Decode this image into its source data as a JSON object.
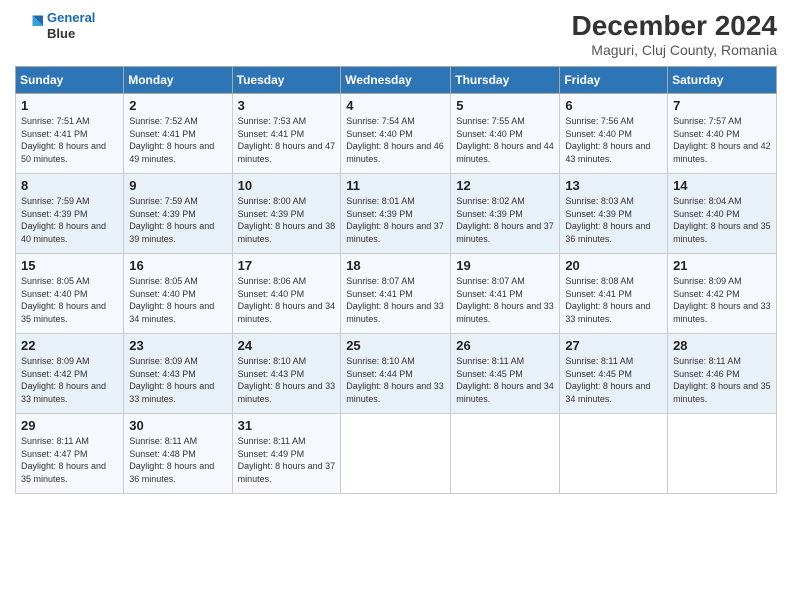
{
  "header": {
    "logo_line1": "General",
    "logo_line2": "Blue",
    "title": "December 2024",
    "subtitle": "Maguri, Cluj County, Romania"
  },
  "weekdays": [
    "Sunday",
    "Monday",
    "Tuesday",
    "Wednesday",
    "Thursday",
    "Friday",
    "Saturday"
  ],
  "weeks": [
    [
      {
        "day": "1",
        "sunrise": "Sunrise: 7:51 AM",
        "sunset": "Sunset: 4:41 PM",
        "daylight": "Daylight: 8 hours and 50 minutes."
      },
      {
        "day": "2",
        "sunrise": "Sunrise: 7:52 AM",
        "sunset": "Sunset: 4:41 PM",
        "daylight": "Daylight: 8 hours and 49 minutes."
      },
      {
        "day": "3",
        "sunrise": "Sunrise: 7:53 AM",
        "sunset": "Sunset: 4:41 PM",
        "daylight": "Daylight: 8 hours and 47 minutes."
      },
      {
        "day": "4",
        "sunrise": "Sunrise: 7:54 AM",
        "sunset": "Sunset: 4:40 PM",
        "daylight": "Daylight: 8 hours and 46 minutes."
      },
      {
        "day": "5",
        "sunrise": "Sunrise: 7:55 AM",
        "sunset": "Sunset: 4:40 PM",
        "daylight": "Daylight: 8 hours and 44 minutes."
      },
      {
        "day": "6",
        "sunrise": "Sunrise: 7:56 AM",
        "sunset": "Sunset: 4:40 PM",
        "daylight": "Daylight: 8 hours and 43 minutes."
      },
      {
        "day": "7",
        "sunrise": "Sunrise: 7:57 AM",
        "sunset": "Sunset: 4:40 PM",
        "daylight": "Daylight: 8 hours and 42 minutes."
      }
    ],
    [
      {
        "day": "8",
        "sunrise": "Sunrise: 7:59 AM",
        "sunset": "Sunset: 4:39 PM",
        "daylight": "Daylight: 8 hours and 40 minutes."
      },
      {
        "day": "9",
        "sunrise": "Sunrise: 7:59 AM",
        "sunset": "Sunset: 4:39 PM",
        "daylight": "Daylight: 8 hours and 39 minutes."
      },
      {
        "day": "10",
        "sunrise": "Sunrise: 8:00 AM",
        "sunset": "Sunset: 4:39 PM",
        "daylight": "Daylight: 8 hours and 38 minutes."
      },
      {
        "day": "11",
        "sunrise": "Sunrise: 8:01 AM",
        "sunset": "Sunset: 4:39 PM",
        "daylight": "Daylight: 8 hours and 37 minutes."
      },
      {
        "day": "12",
        "sunrise": "Sunrise: 8:02 AM",
        "sunset": "Sunset: 4:39 PM",
        "daylight": "Daylight: 8 hours and 37 minutes."
      },
      {
        "day": "13",
        "sunrise": "Sunrise: 8:03 AM",
        "sunset": "Sunset: 4:39 PM",
        "daylight": "Daylight: 8 hours and 36 minutes."
      },
      {
        "day": "14",
        "sunrise": "Sunrise: 8:04 AM",
        "sunset": "Sunset: 4:40 PM",
        "daylight": "Daylight: 8 hours and 35 minutes."
      }
    ],
    [
      {
        "day": "15",
        "sunrise": "Sunrise: 8:05 AM",
        "sunset": "Sunset: 4:40 PM",
        "daylight": "Daylight: 8 hours and 35 minutes."
      },
      {
        "day": "16",
        "sunrise": "Sunrise: 8:05 AM",
        "sunset": "Sunset: 4:40 PM",
        "daylight": "Daylight: 8 hours and 34 minutes."
      },
      {
        "day": "17",
        "sunrise": "Sunrise: 8:06 AM",
        "sunset": "Sunset: 4:40 PM",
        "daylight": "Daylight: 8 hours and 34 minutes."
      },
      {
        "day": "18",
        "sunrise": "Sunrise: 8:07 AM",
        "sunset": "Sunset: 4:41 PM",
        "daylight": "Daylight: 8 hours and 33 minutes."
      },
      {
        "day": "19",
        "sunrise": "Sunrise: 8:07 AM",
        "sunset": "Sunset: 4:41 PM",
        "daylight": "Daylight: 8 hours and 33 minutes."
      },
      {
        "day": "20",
        "sunrise": "Sunrise: 8:08 AM",
        "sunset": "Sunset: 4:41 PM",
        "daylight": "Daylight: 8 hours and 33 minutes."
      },
      {
        "day": "21",
        "sunrise": "Sunrise: 8:09 AM",
        "sunset": "Sunset: 4:42 PM",
        "daylight": "Daylight: 8 hours and 33 minutes."
      }
    ],
    [
      {
        "day": "22",
        "sunrise": "Sunrise: 8:09 AM",
        "sunset": "Sunset: 4:42 PM",
        "daylight": "Daylight: 8 hours and 33 minutes."
      },
      {
        "day": "23",
        "sunrise": "Sunrise: 8:09 AM",
        "sunset": "Sunset: 4:43 PM",
        "daylight": "Daylight: 8 hours and 33 minutes."
      },
      {
        "day": "24",
        "sunrise": "Sunrise: 8:10 AM",
        "sunset": "Sunset: 4:43 PM",
        "daylight": "Daylight: 8 hours and 33 minutes."
      },
      {
        "day": "25",
        "sunrise": "Sunrise: 8:10 AM",
        "sunset": "Sunset: 4:44 PM",
        "daylight": "Daylight: 8 hours and 33 minutes."
      },
      {
        "day": "26",
        "sunrise": "Sunrise: 8:11 AM",
        "sunset": "Sunset: 4:45 PM",
        "daylight": "Daylight: 8 hours and 34 minutes."
      },
      {
        "day": "27",
        "sunrise": "Sunrise: 8:11 AM",
        "sunset": "Sunset: 4:45 PM",
        "daylight": "Daylight: 8 hours and 34 minutes."
      },
      {
        "day": "28",
        "sunrise": "Sunrise: 8:11 AM",
        "sunset": "Sunset: 4:46 PM",
        "daylight": "Daylight: 8 hours and 35 minutes."
      }
    ],
    [
      {
        "day": "29",
        "sunrise": "Sunrise: 8:11 AM",
        "sunset": "Sunset: 4:47 PM",
        "daylight": "Daylight: 8 hours and 35 minutes."
      },
      {
        "day": "30",
        "sunrise": "Sunrise: 8:11 AM",
        "sunset": "Sunset: 4:48 PM",
        "daylight": "Daylight: 8 hours and 36 minutes."
      },
      {
        "day": "31",
        "sunrise": "Sunrise: 8:11 AM",
        "sunset": "Sunset: 4:49 PM",
        "daylight": "Daylight: 8 hours and 37 minutes."
      },
      null,
      null,
      null,
      null
    ]
  ]
}
